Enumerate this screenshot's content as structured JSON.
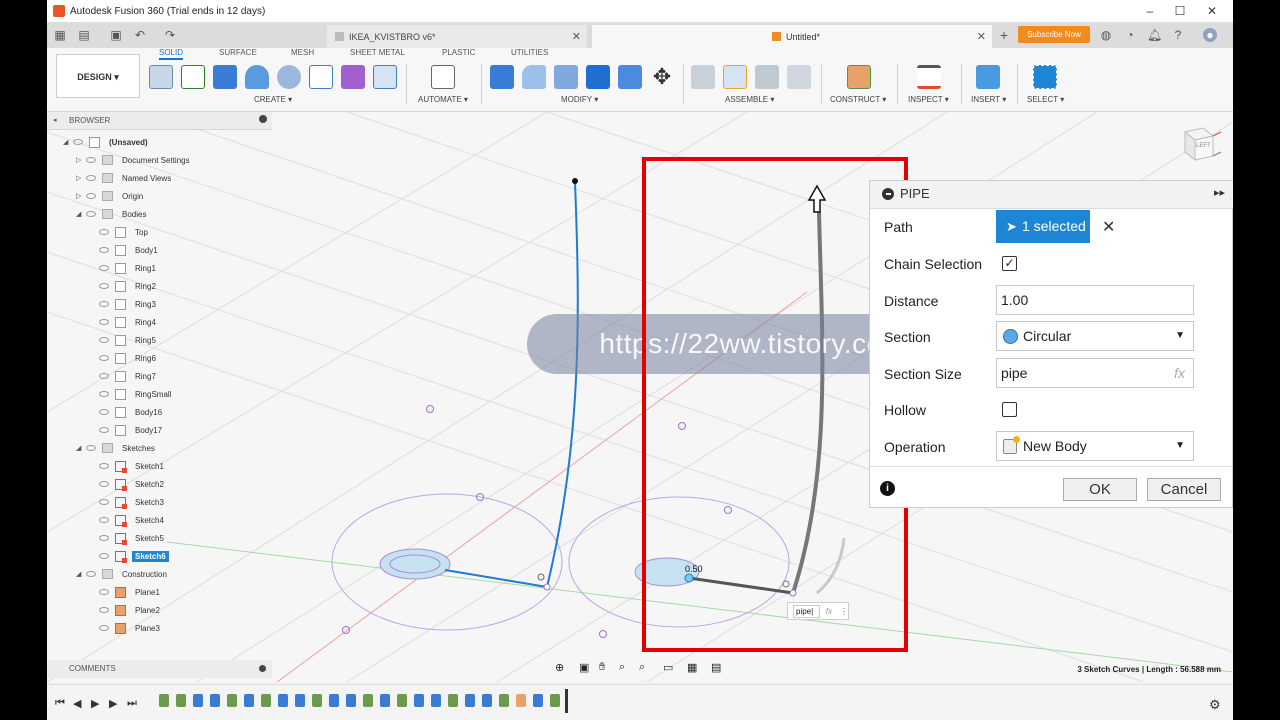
{
  "window": {
    "title": "Autodesk Fusion 360 (Trial ends in 12 days)",
    "minimize": "–",
    "maximize": "☐",
    "close": "✕"
  },
  "tabs": [
    {
      "label": "IKEA_KVISTBRO v6*",
      "close": "✕"
    },
    {
      "label": "Untitled*",
      "close": "✕"
    }
  ],
  "header_right": {
    "new_tab": "+",
    "subscribe": "Subscribe Now"
  },
  "ribbon": {
    "workspace": "DESIGN ▾",
    "tabs": [
      "SOLID",
      "SURFACE",
      "MESH",
      "SHEET METAL",
      "PLASTIC",
      "UTILITIES"
    ],
    "groups": [
      "CREATE ▾",
      "AUTOMATE ▾",
      "MODIFY ▾",
      "ASSEMBLE ▾",
      "CONSTRUCT ▾",
      "INSPECT ▾",
      "INSERT ▾",
      "SELECT ▾"
    ]
  },
  "browser": {
    "title": "BROWSER",
    "items": [
      {
        "label": "(Unsaved)"
      },
      {
        "label": "Document Settings"
      },
      {
        "label": "Named Views"
      },
      {
        "label": "Origin"
      },
      {
        "label": "Bodies"
      },
      {
        "label": "Top"
      },
      {
        "label": "Body1"
      },
      {
        "label": "Ring1"
      },
      {
        "label": "Ring2"
      },
      {
        "label": "Ring3"
      },
      {
        "label": "Ring4"
      },
      {
        "label": "Ring5"
      },
      {
        "label": "Ring6"
      },
      {
        "label": "Ring7"
      },
      {
        "label": "RingSmall"
      },
      {
        "label": "Body16"
      },
      {
        "label": "Body17"
      },
      {
        "label": "Sketches"
      },
      {
        "label": "Sketch1"
      },
      {
        "label": "Sketch2"
      },
      {
        "label": "Sketch3"
      },
      {
        "label": "Sketch4"
      },
      {
        "label": "Sketch5"
      },
      {
        "label": "Sketch6"
      },
      {
        "label": "Construction"
      },
      {
        "label": "Plane1"
      },
      {
        "label": "Plane2"
      },
      {
        "label": "Plane3"
      }
    ]
  },
  "comments": {
    "title": "COMMENTS"
  },
  "viewcube": {
    "label": "LEFT"
  },
  "pipe": {
    "title": "PIPE",
    "rows": {
      "path_label": "Path",
      "path_value": "1 selected",
      "chain_label": "Chain Selection",
      "distance_label": "Distance",
      "distance_value": "1.00",
      "section_label": "Section",
      "section_value": "Circular",
      "size_label": "Section Size",
      "size_value": "pipe",
      "fx": "fx",
      "hollow_label": "Hollow",
      "operation_label": "Operation",
      "operation_value": "New Body"
    },
    "ok": "OK",
    "cancel": "Cancel"
  },
  "canvas": {
    "dimension_label": "0.50",
    "inline_input": "pipe|",
    "inline_fx": "fx",
    "inline_menu": "⋮"
  },
  "watermark": "https://22ww.tistory.com",
  "status": "3 Sketch Curves | Length : 56.588 mm"
}
